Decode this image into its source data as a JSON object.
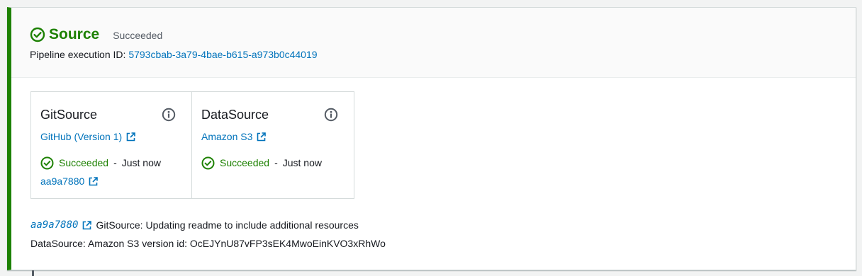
{
  "stage": {
    "title": "Source",
    "status": "Succeeded",
    "execution_id_label": "Pipeline execution ID:",
    "execution_id": "5793cbab-3a79-4bae-b615-a973b0c44019",
    "accent_color": "#1d8102"
  },
  "actions": [
    {
      "name": "GitSource",
      "provider": "GitHub (Version 1)",
      "status": "Succeeded",
      "separator": "-",
      "time": "Just now",
      "revision": "aa9a7880"
    },
    {
      "name": "DataSource",
      "provider": "Amazon S3",
      "status": "Succeeded",
      "separator": "-",
      "time": "Just now"
    }
  ],
  "summary": {
    "commit_id": "aa9a7880",
    "commit_message": "GitSource: Updating readme to include additional resources",
    "data_source_line": "DataSource: Amazon S3 version id: OcEJYnU87vFP3sEK4MwoEinKVO3xRhWo"
  },
  "icons": {
    "success": "check-circle-icon",
    "info": "info-icon",
    "external": "external-link-icon"
  },
  "colors": {
    "success": "#1d8102",
    "link": "#0073bb",
    "muted": "#545b64"
  }
}
